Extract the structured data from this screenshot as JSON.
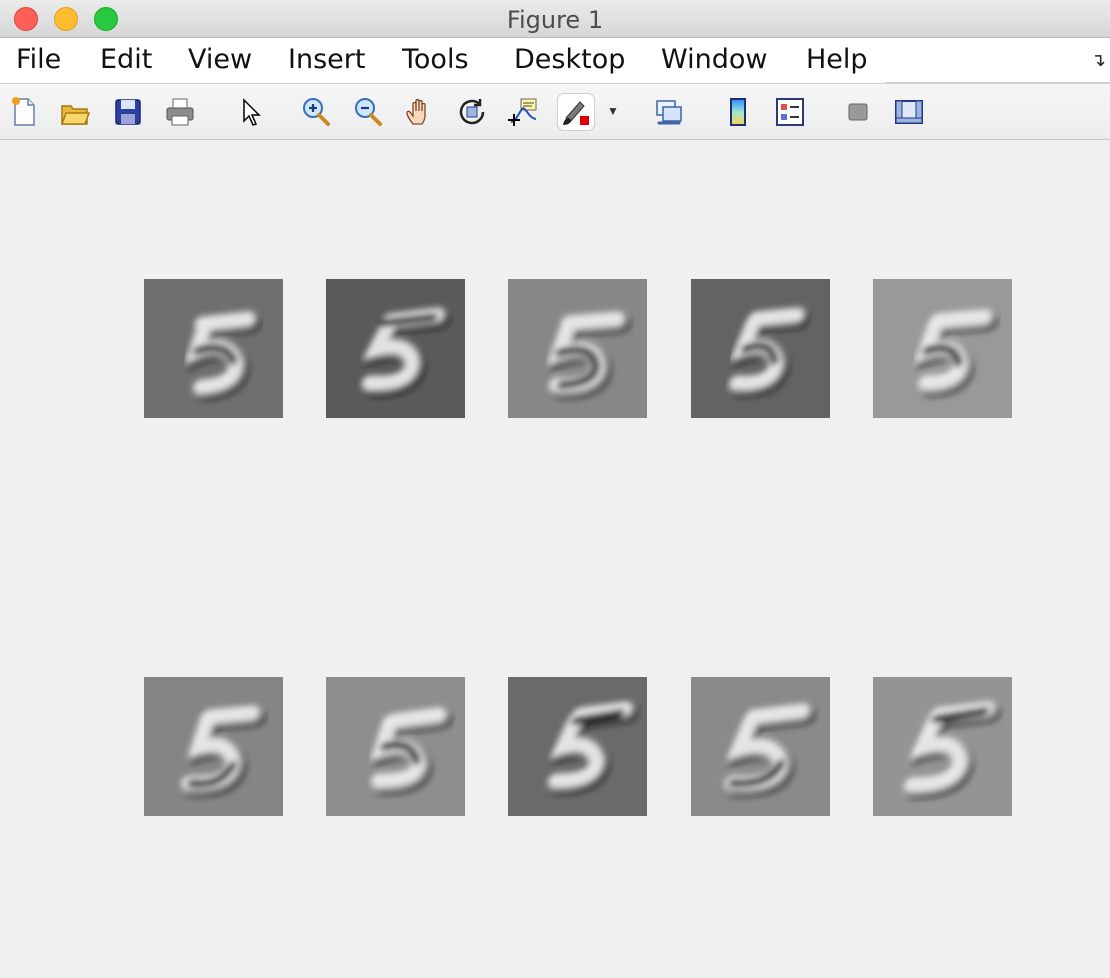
{
  "window": {
    "title": "Figure 1"
  },
  "menu": [
    "File",
    "Edit",
    "View",
    "Insert",
    "Tools",
    "Desktop",
    "Window",
    "Help"
  ],
  "toolbar": [
    "new-figure-icon",
    "open-file-icon",
    "save-icon",
    "print-icon",
    "select-pointer-icon",
    "zoom-in-icon",
    "zoom-out-icon",
    "pan-hand-icon",
    "rotate-3d-icon",
    "data-cursor-icon",
    "brush-icon",
    "link-plot-icon",
    "colorbar-icon",
    "legend-icon",
    "hide-plot-tools-icon",
    "show-plot-tools-icon"
  ],
  "tiles": [
    {
      "bg": "#6f6f6f"
    },
    {
      "bg": "#5a5a5a"
    },
    {
      "bg": "#878787"
    },
    {
      "bg": "#636363"
    },
    {
      "bg": "#999999"
    },
    {
      "bg": "#858585"
    },
    {
      "bg": "#8e8e8e"
    },
    {
      "bg": "#6a6a6a"
    },
    {
      "bg": "#8a8a8a"
    },
    {
      "bg": "#949494"
    }
  ]
}
